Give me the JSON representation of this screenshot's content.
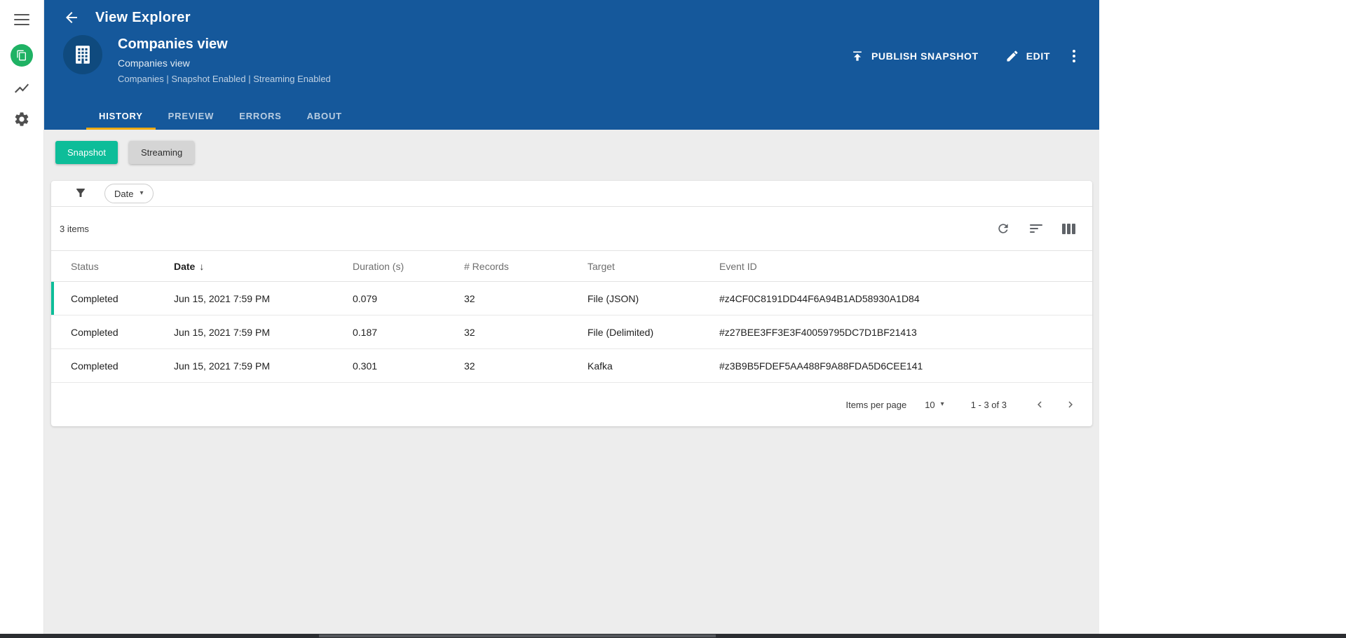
{
  "colors": {
    "accent": "#0dbd99",
    "header_blue": "#15589b",
    "tab_underline": "#edaa13",
    "sidebar_green": "#1fb264",
    "content_bg": "#ededed",
    "avatar_blue": "#0f4a7e"
  },
  "header": {
    "title": "View Explorer",
    "entity": {
      "name": "Companies view",
      "subtitle": "Companies view",
      "meta": "Companies | Snapshot Enabled | Streaming Enabled"
    },
    "actions": {
      "publish": "PUBLISH SNAPSHOT",
      "edit": "EDIT"
    },
    "tabs": [
      {
        "label": "HISTORY",
        "active": true
      },
      {
        "label": "PREVIEW",
        "active": false
      },
      {
        "label": "ERRORS",
        "active": false
      },
      {
        "label": "ABOUT",
        "active": false
      }
    ]
  },
  "toggles": [
    {
      "label": "Snapshot",
      "active": true
    },
    {
      "label": "Streaming",
      "active": false
    }
  ],
  "filter": {
    "chip_label": "Date"
  },
  "table": {
    "items_count": "3 items",
    "columns": [
      "Status",
      "Date",
      "Duration (s)",
      "# Records",
      "Target",
      "Event ID"
    ],
    "sort": {
      "column": "Date",
      "direction": "desc"
    },
    "rows": [
      {
        "status": "Completed",
        "date": "Jun 15, 2021 7:59 PM",
        "duration": "0.079",
        "records": "32",
        "target": "File (JSON)",
        "event_id": "#z4CF0C8191DD44F6A94B1AD58930A1D84",
        "selected": true
      },
      {
        "status": "Completed",
        "date": "Jun 15, 2021 7:59 PM",
        "duration": "0.187",
        "records": "32",
        "target": "File (Delimited)",
        "event_id": "#z27BEE3FF3E3F40059795DC7D1BF21413",
        "selected": false
      },
      {
        "status": "Completed",
        "date": "Jun 15, 2021 7:59 PM",
        "duration": "0.301",
        "records": "32",
        "target": "Kafka",
        "event_id": "#z3B9B5FDEF5AA488F9A88FDA5D6CEE141",
        "selected": false
      }
    ]
  },
  "pagination": {
    "items_per_page_label": "Items per page",
    "per_page": "10",
    "range": "1 - 3 of 3"
  },
  "icons": {
    "sort_desc": "↓",
    "caret_down": "▾"
  }
}
